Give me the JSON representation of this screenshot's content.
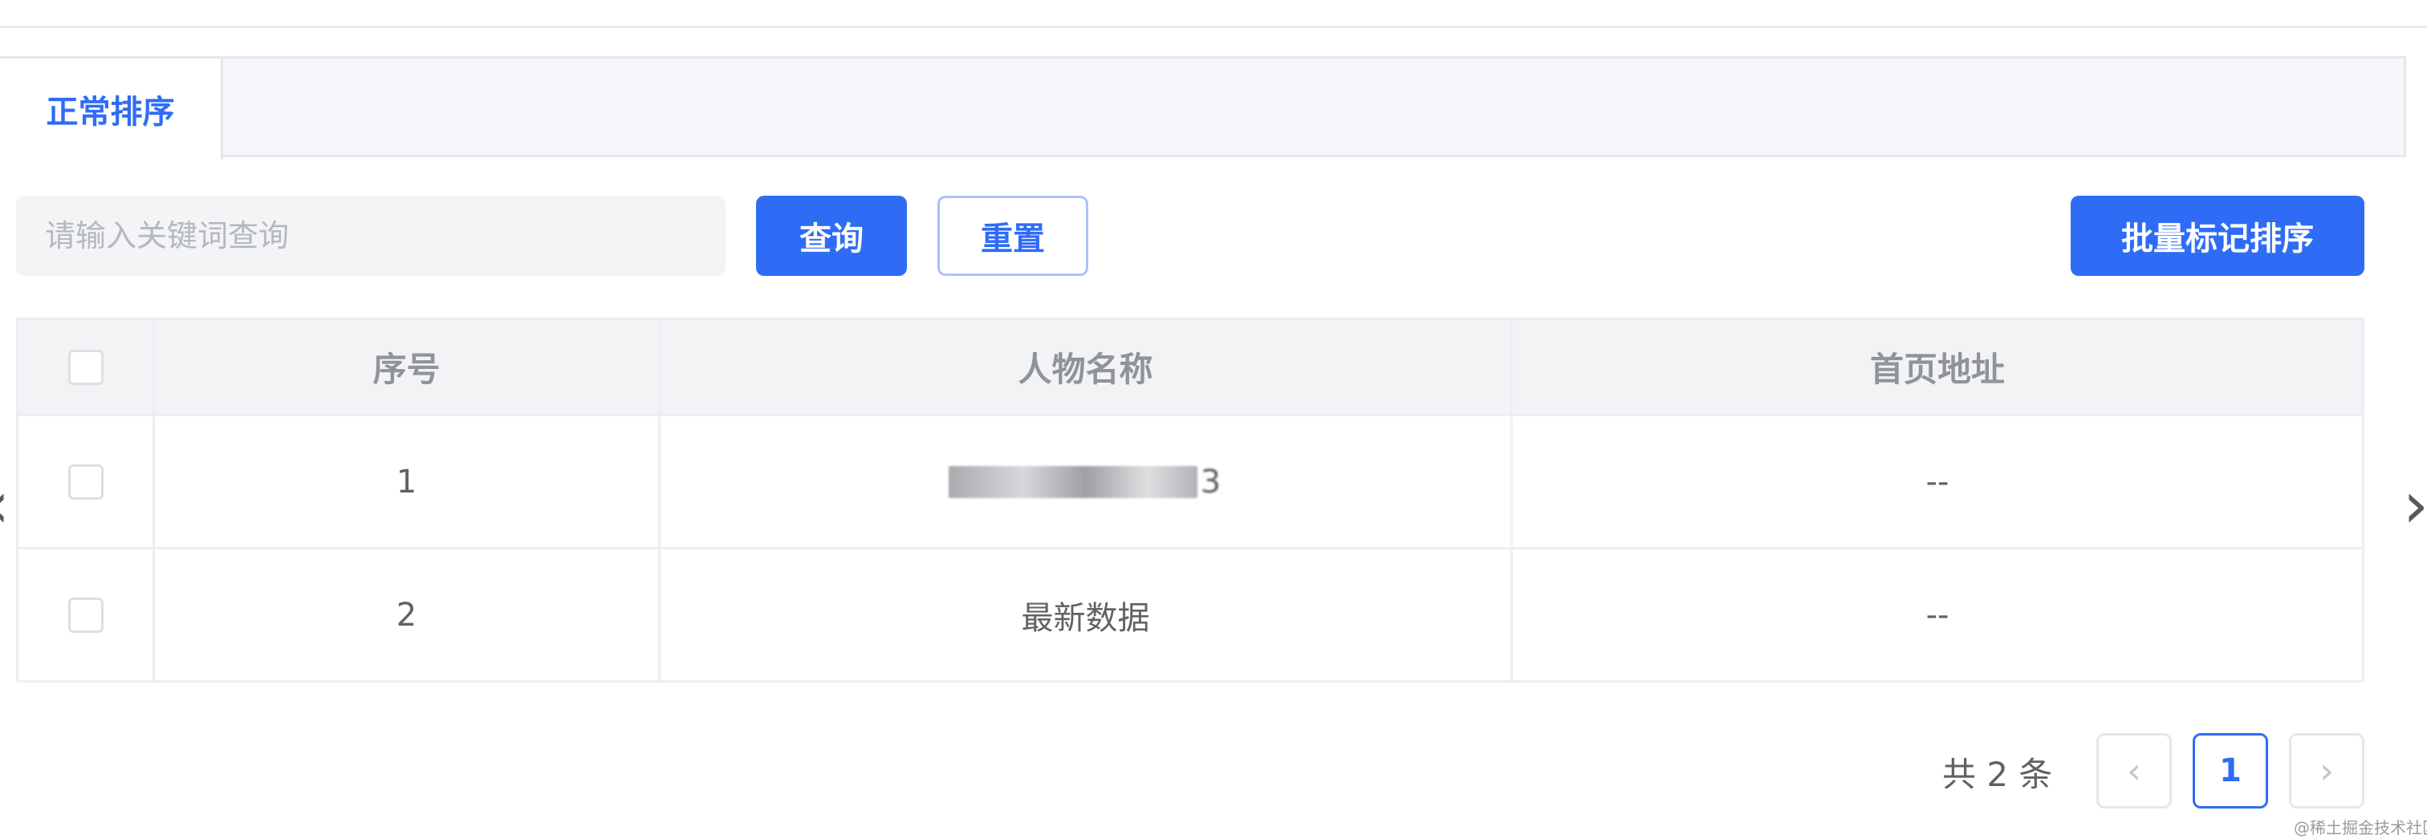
{
  "tabs": [
    {
      "label": "正常排序",
      "active": true
    }
  ],
  "search": {
    "placeholder": "请输入关键词查询",
    "value": ""
  },
  "toolbar": {
    "query_label": "查询",
    "reset_label": "重置",
    "batch_label": "批量标记排序"
  },
  "table": {
    "columns": [
      "序号",
      "人物名称",
      "首页地址"
    ],
    "rows": [
      {
        "seq": "1",
        "name": "3",
        "url": "--",
        "name_obscured": true
      },
      {
        "seq": "2",
        "name": "最新数据",
        "url": "--"
      }
    ]
  },
  "pagination": {
    "total": "共 2 条",
    "prev": "‹",
    "current": "1",
    "next": "›"
  },
  "nav": {
    "left": "‹",
    "right": "›"
  },
  "watermark": "@稀土掘金技术社区",
  "colors": {
    "accent": "#2f6cf6",
    "border": "#ebeef5",
    "header_bg": "#f2f3f5"
  }
}
